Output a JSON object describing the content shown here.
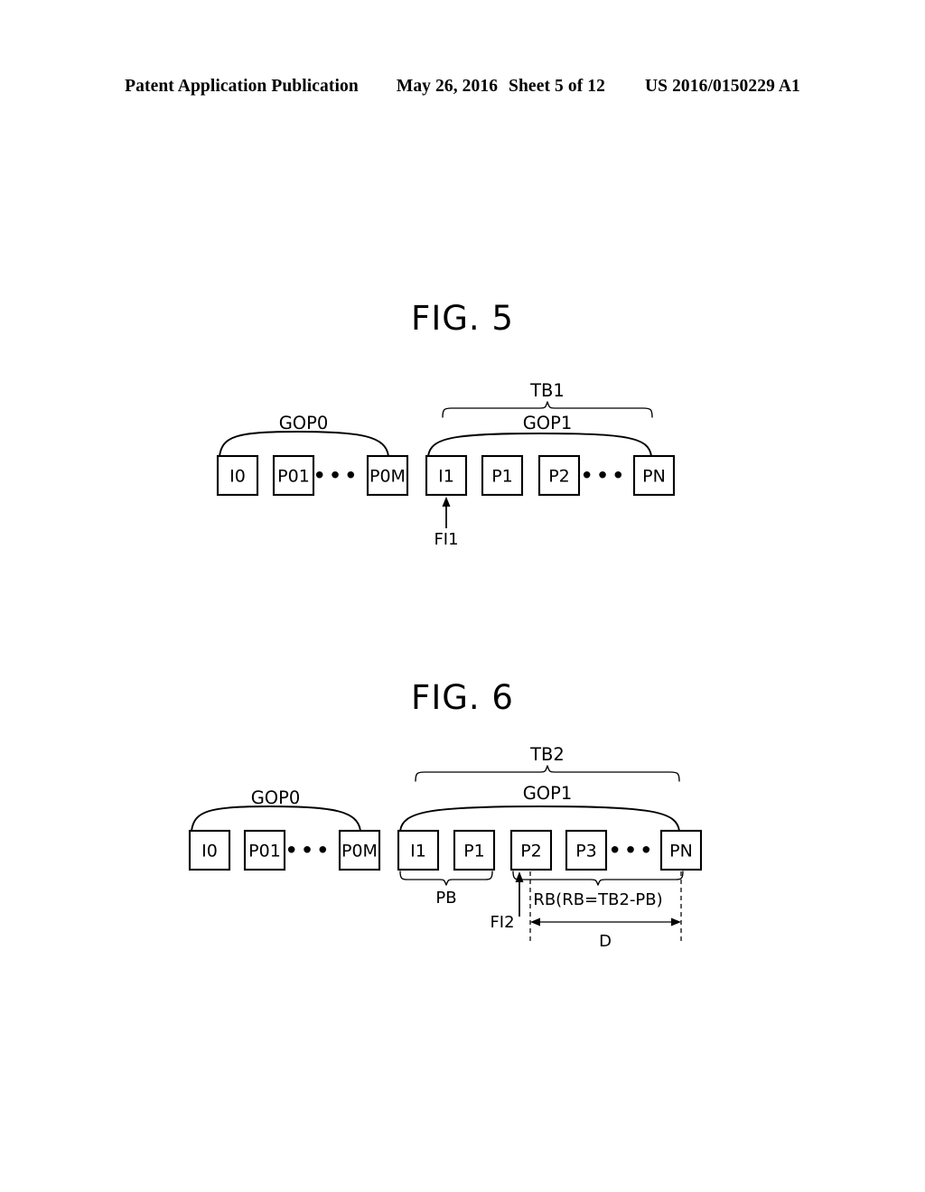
{
  "header": {
    "publication": "Patent Application Publication",
    "date": "May 26, 2016",
    "sheet": "Sheet 5 of 12",
    "number": "US 2016/0150229 A1"
  },
  "figures": [
    {
      "title": "FIG. 5",
      "groups": [
        {
          "name": "GOP0",
          "label": "GOP0",
          "frames": [
            {
              "id": "I0",
              "label": "I0"
            },
            {
              "id": "P01",
              "label": "P01"
            },
            {
              "id": "ellipsis0",
              "label": "•••"
            },
            {
              "id": "P0M",
              "label": "P0M"
            }
          ]
        },
        {
          "name": "GOP1",
          "label": "GOP1",
          "frames": [
            {
              "id": "I1",
              "label": "I1"
            },
            {
              "id": "P1",
              "label": "P1"
            },
            {
              "id": "P2",
              "label": "P2"
            },
            {
              "id": "ellipsis1",
              "label": "•••"
            },
            {
              "id": "PN",
              "label": "PN"
            }
          ]
        }
      ],
      "annotations": {
        "total_buffer": "TB1",
        "frame_indicator": "FI1"
      }
    },
    {
      "title": "FIG. 6",
      "groups": [
        {
          "name": "GOP0",
          "label": "GOP0",
          "frames": [
            {
              "id": "I0",
              "label": "I0"
            },
            {
              "id": "P01",
              "label": "P01"
            },
            {
              "id": "ellipsis0",
              "label": "•••"
            },
            {
              "id": "P0M",
              "label": "P0M"
            }
          ]
        },
        {
          "name": "GOP1",
          "label": "GOP1",
          "frames": [
            {
              "id": "I1",
              "label": "I1"
            },
            {
              "id": "P1",
              "label": "P1"
            },
            {
              "id": "P2",
              "label": "P2"
            },
            {
              "id": "P3",
              "label": "P3"
            },
            {
              "id": "ellipsis1",
              "label": "•••"
            },
            {
              "id": "PN",
              "label": "PN"
            }
          ]
        }
      ],
      "annotations": {
        "total_buffer": "TB2",
        "played_buffer": "PB",
        "remaining_buffer": "RB(RB=TB2-PB)",
        "frame_indicator": "FI2",
        "duration": "D"
      }
    }
  ],
  "colors": {
    "ink": "#000000",
    "paper": "#ffffff"
  }
}
